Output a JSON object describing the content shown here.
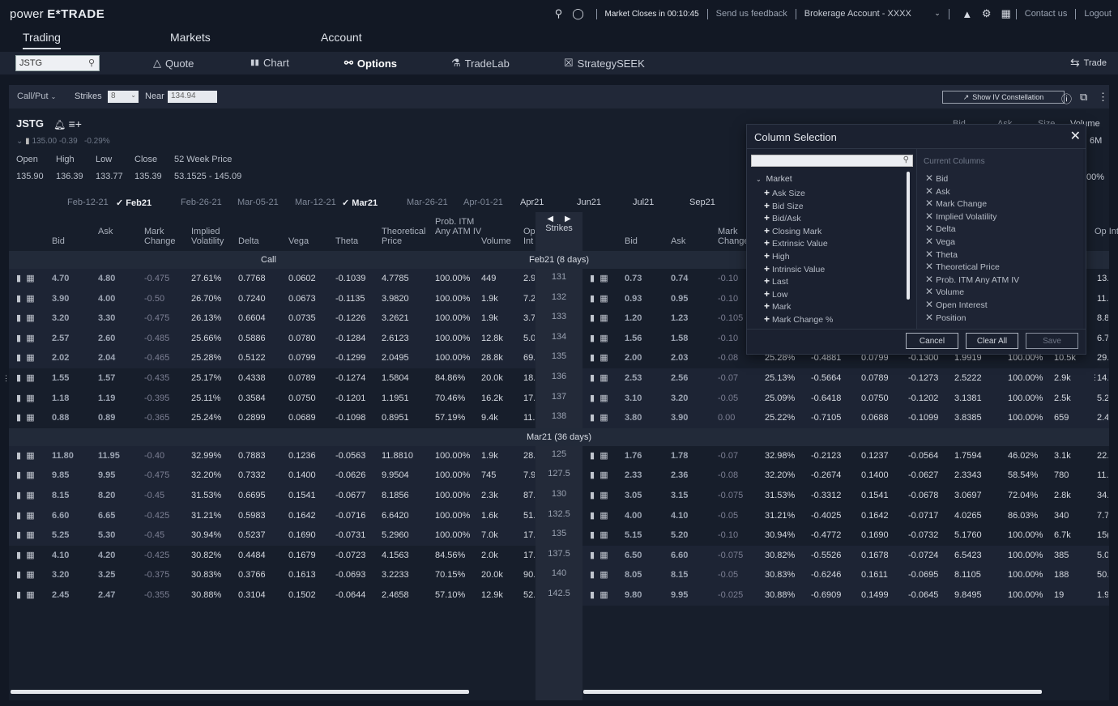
{
  "brand": {
    "prefix": "power",
    "name": "E*TRADE"
  },
  "topbar": {
    "market_close": "Market Closes in 00:10:45",
    "feedback": "Send us feedback",
    "account": "Brokerage Account - XXXX",
    "contact": "Contact us",
    "logout": "Logout"
  },
  "main_tabs": [
    {
      "label": "Trading",
      "active": true
    },
    {
      "label": "Markets"
    },
    {
      "label": "Account"
    }
  ],
  "subnav": {
    "symbol": "JSTG",
    "items": [
      {
        "label": "Quote",
        "icon": "△"
      },
      {
        "label": "Chart",
        "icon": "▮▮"
      },
      {
        "label": "Options",
        "icon": "⚯",
        "active": true
      },
      {
        "label": "TradeLab",
        "icon": "⚗"
      },
      {
        "label": "StrategySEEK",
        "icon": "☒"
      }
    ],
    "trade_label": "Trade"
  },
  "toolbar": {
    "callput": "Call/Put",
    "strikes_label": "Strikes",
    "strikes_value": "8",
    "near_label": "Near",
    "near_value": "134.94",
    "iv_button": "Show IV Constellation"
  },
  "quote": {
    "symbol": "JSTG",
    "last": "135.00",
    "change": "-0.39",
    "change_pct": "-0.29%",
    "labels": [
      "Open",
      "High",
      "Low",
      "Close",
      "52 Week Price"
    ],
    "values": [
      "135.90",
      "136.39",
      "133.77",
      "135.39",
      "53.1525 - 145.09"
    ],
    "right_headers": [
      "Bid",
      "Ask",
      "Size",
      "Volume"
    ],
    "right_volume": "6M",
    "right_pct": "00%"
  },
  "expirations": [
    {
      "label": "Feb-12-21"
    },
    {
      "label": "Feb21",
      "selected": true
    },
    {
      "label": "Feb-26-21"
    },
    {
      "label": "Mar-05-21"
    },
    {
      "label": "Mar-12-21"
    },
    {
      "label": "Mar21",
      "selected": true
    },
    {
      "label": "Mar-26-21"
    },
    {
      "label": "Apr-01-21"
    },
    {
      "label": "Apr21",
      "month": true
    },
    {
      "label": "Jun21",
      "month": true
    },
    {
      "label": "Jul21",
      "month": true
    },
    {
      "label": "Sep21",
      "month": true
    }
  ],
  "call_headers": [
    "Bid",
    "Ask",
    "Mark Change",
    "Implied Volatility",
    "Delta",
    "Vega",
    "Theta",
    "Theoretical Price",
    "Prob. ITM Any ATM IV",
    "Volume",
    "Op Int"
  ],
  "put_headers": [
    "Bid",
    "Ask",
    "Mark Change",
    "Op Int"
  ],
  "strikes_header": "Strikes",
  "call_label": "Call",
  "sections": [
    {
      "label": "Feb21 (8 days)",
      "rows": [
        {
          "strike": "131",
          "itm_call": true,
          "call": [
            "4.70",
            "4.80",
            "-0.475",
            "27.61%",
            "0.7768",
            "0.0602",
            "-0.1039",
            "4.7785",
            "100.00%",
            "449",
            "2.9"
          ],
          "put": [
            "0.73",
            "0.74",
            "-0.10",
            "",
            "",
            "",
            "",
            "",
            "",
            "",
            "13."
          ]
        },
        {
          "strike": "132",
          "itm_call": true,
          "call": [
            "3.90",
            "4.00",
            "-0.50",
            "26.70%",
            "0.7240",
            "0.0673",
            "-0.1135",
            "3.9820",
            "100.00%",
            "1.9k",
            "7.2"
          ],
          "put": [
            "0.93",
            "0.95",
            "-0.10",
            "",
            "",
            "",
            "",
            "",
            "",
            "",
            "11."
          ]
        },
        {
          "strike": "133",
          "itm_call": true,
          "call": [
            "3.20",
            "3.30",
            "-0.475",
            "26.13%",
            "0.6604",
            "0.0735",
            "-0.1226",
            "3.2621",
            "100.00%",
            "1.9k",
            "3.7"
          ],
          "put": [
            "1.20",
            "1.23",
            "-0.105",
            "",
            "",
            "",
            "",
            "",
            "",
            "",
            "8.8"
          ]
        },
        {
          "strike": "134",
          "itm_call": true,
          "call": [
            "2.57",
            "2.60",
            "-0.485",
            "25.66%",
            "0.5886",
            "0.0780",
            "-0.1284",
            "2.6123",
            "100.00%",
            "12.8k",
            "5.0"
          ],
          "put": [
            "1.56",
            "1.58",
            "-0.10",
            "",
            "",
            "",
            "",
            "",
            "",
            "",
            "6.7"
          ]
        },
        {
          "strike": "135",
          "itm_call": true,
          "call": [
            "2.02",
            "2.04",
            "-0.465",
            "25.28%",
            "0.5122",
            "0.0799",
            "-0.1299",
            "2.0495",
            "100.00%",
            "28.8k",
            "69."
          ],
          "put": [
            "2.00",
            "2.03",
            "-0.08",
            "25.28%",
            "-0.4881",
            "0.0799",
            "-0.1300",
            "1.9919",
            "100.00%",
            "10.5k",
            "29."
          ]
        },
        {
          "strike": "136",
          "call": [
            "1.55",
            "1.57",
            "-0.435",
            "25.17%",
            "0.4338",
            "0.0789",
            "-0.1274",
            "1.5804",
            "84.86%",
            "20.0k",
            "18."
          ],
          "put": [
            "2.53",
            "2.56",
            "-0.07",
            "25.13%",
            "-0.5664",
            "0.0789",
            "-0.1273",
            "2.5222",
            "100.00%",
            "2.9k",
            "14."
          ]
        },
        {
          "strike": "137",
          "call": [
            "1.18",
            "1.19",
            "-0.395",
            "25.11%",
            "0.3584",
            "0.0750",
            "-0.1201",
            "1.1951",
            "70.46%",
            "16.2k",
            "17."
          ],
          "put": [
            "3.10",
            "3.20",
            "-0.05",
            "25.09%",
            "-0.6418",
            "0.0750",
            "-0.1202",
            "3.1381",
            "100.00%",
            "2.5k",
            "5.2"
          ]
        },
        {
          "strike": "138",
          "call": [
            "0.88",
            "0.89",
            "-0.365",
            "25.24%",
            "0.2899",
            "0.0689",
            "-0.1098",
            "0.8951",
            "57.19%",
            "9.4k",
            "11."
          ],
          "put": [
            "3.80",
            "3.90",
            "0.00",
            "25.22%",
            "-0.7105",
            "0.0688",
            "-0.1099",
            "3.8385",
            "100.00%",
            "659",
            "2.4"
          ]
        }
      ]
    },
    {
      "label": "Mar21 (36 days)",
      "rows": [
        {
          "strike": "125",
          "itm_call": true,
          "call": [
            "11.80",
            "11.95",
            "-0.40",
            "32.99%",
            "0.7883",
            "0.1236",
            "-0.0563",
            "11.8810",
            "100.00%",
            "1.9k",
            "28."
          ],
          "put": [
            "1.76",
            "1.78",
            "-0.07",
            "32.98%",
            "-0.2123",
            "0.1237",
            "-0.0564",
            "1.7594",
            "46.02%",
            "3.1k",
            "22."
          ]
        },
        {
          "strike": "127.5",
          "itm_call": true,
          "call": [
            "9.85",
            "9.95",
            "-0.475",
            "32.20%",
            "0.7332",
            "0.1400",
            "-0.0626",
            "9.9504",
            "100.00%",
            "745",
            "7.9"
          ],
          "put": [
            "2.33",
            "2.36",
            "-0.08",
            "32.20%",
            "-0.2674",
            "0.1400",
            "-0.0627",
            "2.3343",
            "58.54%",
            "780",
            "11."
          ]
        },
        {
          "strike": "130",
          "itm_call": true,
          "call": [
            "8.15",
            "8.20",
            "-0.45",
            "31.53%",
            "0.6695",
            "0.1541",
            "-0.0677",
            "8.1856",
            "100.00%",
            "2.3k",
            "87."
          ],
          "put": [
            "3.05",
            "3.15",
            "-0.075",
            "31.53%",
            "-0.3312",
            "0.1541",
            "-0.0678",
            "3.0697",
            "72.04%",
            "2.8k",
            "34."
          ]
        },
        {
          "strike": "132.5",
          "itm_call": true,
          "call": [
            "6.60",
            "6.65",
            "-0.425",
            "31.21%",
            "0.5983",
            "0.1642",
            "-0.0716",
            "6.6420",
            "100.00%",
            "1.6k",
            "51."
          ],
          "put": [
            "4.00",
            "4.10",
            "-0.05",
            "31.21%",
            "-0.4025",
            "0.1642",
            "-0.0717",
            "4.0265",
            "86.03%",
            "340",
            "7.7"
          ]
        },
        {
          "strike": "135",
          "itm_call": true,
          "call": [
            "5.25",
            "5.30",
            "-0.45",
            "30.94%",
            "0.5237",
            "0.1690",
            "-0.0731",
            "5.2960",
            "100.00%",
            "7.0k",
            "17."
          ],
          "put": [
            "5.15",
            "5.20",
            "-0.10",
            "30.94%",
            "-0.4772",
            "0.1690",
            "-0.0732",
            "5.1760",
            "100.00%",
            "6.7k",
            "15("
          ]
        },
        {
          "strike": "137.5",
          "call": [
            "4.10",
            "4.20",
            "-0.425",
            "30.82%",
            "0.4484",
            "0.1679",
            "-0.0723",
            "4.1563",
            "84.56%",
            "2.0k",
            "17."
          ],
          "put": [
            "6.50",
            "6.60",
            "-0.075",
            "30.82%",
            "-0.5526",
            "0.1678",
            "-0.0724",
            "6.5423",
            "100.00%",
            "385",
            "5.0"
          ]
        },
        {
          "strike": "140",
          "call": [
            "3.20",
            "3.25",
            "-0.375",
            "30.83%",
            "0.3766",
            "0.1613",
            "-0.0693",
            "3.2233",
            "70.15%",
            "20.0k",
            "90."
          ],
          "put": [
            "8.05",
            "8.15",
            "-0.05",
            "30.83%",
            "-0.6246",
            "0.1611",
            "-0.0695",
            "8.1105",
            "100.00%",
            "188",
            "50."
          ]
        },
        {
          "strike": "142.5",
          "call": [
            "2.45",
            "2.47",
            "-0.355",
            "30.88%",
            "0.3104",
            "0.1502",
            "-0.0644",
            "2.4658",
            "57.10%",
            "12.9k",
            "52."
          ],
          "put": [
            "9.80",
            "9.95",
            "-0.025",
            "30.88%",
            "-0.6909",
            "0.1499",
            "-0.0645",
            "9.8495",
            "100.00%",
            "19",
            "1.9"
          ]
        }
      ]
    }
  ],
  "column_selection": {
    "title": "Column Selection",
    "search_placeholder": "",
    "group": "Market",
    "available": [
      "Ask Size",
      "Bid Size",
      "Bid/Ask",
      "Closing Mark",
      "Extrinsic Value",
      "High",
      "Intrinsic Value",
      "Last",
      "Low",
      "Mark",
      "Mark Change %"
    ],
    "current_title": "Current Columns",
    "current": [
      "Bid",
      "Ask",
      "Mark Change",
      "Implied Volatility",
      "Delta",
      "Vega",
      "Theta",
      "Theoretical Price",
      "Prob. ITM Any ATM IV",
      "Volume",
      "Open Interest",
      "Position"
    ],
    "cancel": "Cancel",
    "clear_all": "Clear All",
    "save": "Save"
  },
  "colors": {
    "background": "#121824",
    "panel": "#171e2b",
    "itm_row": "#1d2434",
    "strike_column": "#232a39",
    "accent_text": "#eef0f4"
  }
}
